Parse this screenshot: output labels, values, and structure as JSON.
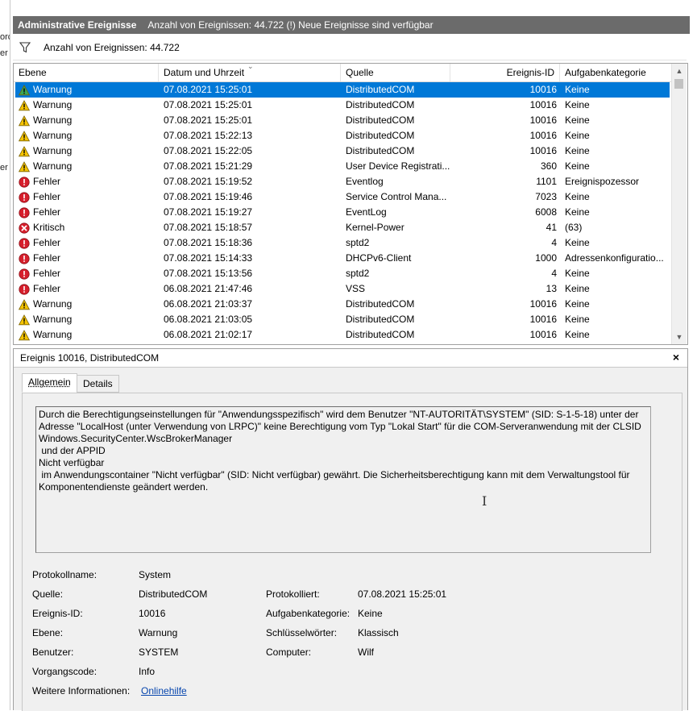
{
  "left_strip": [
    "orc",
    "er",
    "er"
  ],
  "header": {
    "title": "Administrative Ereignisse",
    "subtitle": "Anzahl von Ereignissen: 44.722 (!) Neue Ereignisse sind verfügbar"
  },
  "filter": {
    "count_label": "Anzahl von Ereignissen: 44.722"
  },
  "grid": {
    "columns": [
      "Ebene",
      "Datum und Uhrzeit",
      "Quelle",
      "Ereignis-ID",
      "Aufgabenkategorie"
    ],
    "rows": [
      {
        "icon": "warning",
        "level": "Warnung",
        "date": "07.08.2021 15:25:01",
        "source": "DistributedCOM",
        "id": "10016",
        "category": "Keine",
        "selected": true
      },
      {
        "icon": "warning",
        "level": "Warnung",
        "date": "07.08.2021 15:25:01",
        "source": "DistributedCOM",
        "id": "10016",
        "category": "Keine"
      },
      {
        "icon": "warning",
        "level": "Warnung",
        "date": "07.08.2021 15:25:01",
        "source": "DistributedCOM",
        "id": "10016",
        "category": "Keine"
      },
      {
        "icon": "warning",
        "level": "Warnung",
        "date": "07.08.2021 15:22:13",
        "source": "DistributedCOM",
        "id": "10016",
        "category": "Keine"
      },
      {
        "icon": "warning",
        "level": "Warnung",
        "date": "07.08.2021 15:22:05",
        "source": "DistributedCOM",
        "id": "10016",
        "category": "Keine"
      },
      {
        "icon": "warning",
        "level": "Warnung",
        "date": "07.08.2021 15:21:29",
        "source": "User Device Registrati...",
        "id": "360",
        "category": "Keine"
      },
      {
        "icon": "error",
        "level": "Fehler",
        "date": "07.08.2021 15:19:52",
        "source": "Eventlog",
        "id": "1101",
        "category": "Ereignispozessor"
      },
      {
        "icon": "error",
        "level": "Fehler",
        "date": "07.08.2021 15:19:46",
        "source": "Service Control Mana...",
        "id": "7023",
        "category": "Keine"
      },
      {
        "icon": "error",
        "level": "Fehler",
        "date": "07.08.2021 15:19:27",
        "source": "EventLog",
        "id": "6008",
        "category": "Keine"
      },
      {
        "icon": "critical",
        "level": "Kritisch",
        "date": "07.08.2021 15:18:57",
        "source": "Kernel-Power",
        "id": "41",
        "category": "(63)"
      },
      {
        "icon": "error",
        "level": "Fehler",
        "date": "07.08.2021 15:18:36",
        "source": "sptd2",
        "id": "4",
        "category": "Keine"
      },
      {
        "icon": "error",
        "level": "Fehler",
        "date": "07.08.2021 15:14:33",
        "source": "DHCPv6-Client",
        "id": "1000",
        "category": "Adressenkonfiguratio..."
      },
      {
        "icon": "error",
        "level": "Fehler",
        "date": "07.08.2021 15:13:56",
        "source": "sptd2",
        "id": "4",
        "category": "Keine"
      },
      {
        "icon": "error",
        "level": "Fehler",
        "date": "06.08.2021 21:47:46",
        "source": "VSS",
        "id": "13",
        "category": "Keine"
      },
      {
        "icon": "warning",
        "level": "Warnung",
        "date": "06.08.2021 21:03:37",
        "source": "DistributedCOM",
        "id": "10016",
        "category": "Keine"
      },
      {
        "icon": "warning",
        "level": "Warnung",
        "date": "06.08.2021 21:03:05",
        "source": "DistributedCOM",
        "id": "10016",
        "category": "Keine"
      },
      {
        "icon": "warning",
        "level": "Warnung",
        "date": "06.08.2021 21:02:17",
        "source": "DistributedCOM",
        "id": "10016",
        "category": "Keine"
      }
    ]
  },
  "detail": {
    "title": "Ereignis 10016, DistributedCOM",
    "close": "×",
    "tabs": [
      "Allgemein",
      "Details"
    ],
    "message": "Durch die Berechtigungseinstellungen für \"Anwendungsspezifisch\" wird dem Benutzer \"NT-AUTORITÄT\\SYSTEM\" (SID: S-1-5-18) unter der\nAdresse \"LocalHost (unter Verwendung von LRPC)\" keine Berechtigung vom Typ \"Lokal Start\" für die COM-Serveranwendung mit der CLSID\nWindows.SecurityCenter.WscBrokerManager\n und der APPID\nNicht verfügbar\n im Anwendungscontainer \"Nicht verfügbar\" (SID: Nicht verfügbar) gewährt. Die Sicherheitsberechtigung kann mit dem Verwaltungstool für\nKomponentendienste geändert werden.",
    "props": {
      "protokollname_label": "Protokollname:",
      "protokollname": "System",
      "quelle_label": "Quelle:",
      "quelle": "DistributedCOM",
      "protokolliert_label": "Protokolliert:",
      "protokolliert": "07.08.2021 15:25:01",
      "ereignis_id_label": "Ereignis-ID:",
      "ereignis_id": "10016",
      "aufgabenkategorie_label": "Aufgabenkategorie:",
      "aufgabenkategorie": "Keine",
      "ebene_label": "Ebene:",
      "ebene": "Warnung",
      "schluesselwoerter_label": "Schlüsselwörter:",
      "schluesselwoerter": "Klassisch",
      "benutzer_label": "Benutzer:",
      "benutzer": "SYSTEM",
      "computer_label": "Computer:",
      "computer": "Wilf",
      "vorgangscode_label": "Vorgangscode:",
      "vorgangscode": "Info",
      "weitere_label": "Weitere Informationen:",
      "weitere_link": "Onlinehilfe"
    }
  },
  "colors": {
    "selection": "#0078d7",
    "titlebar": "#6b6b6b",
    "warning": "#f5c400",
    "error": "#d61f2c",
    "link": "#0645ad"
  }
}
